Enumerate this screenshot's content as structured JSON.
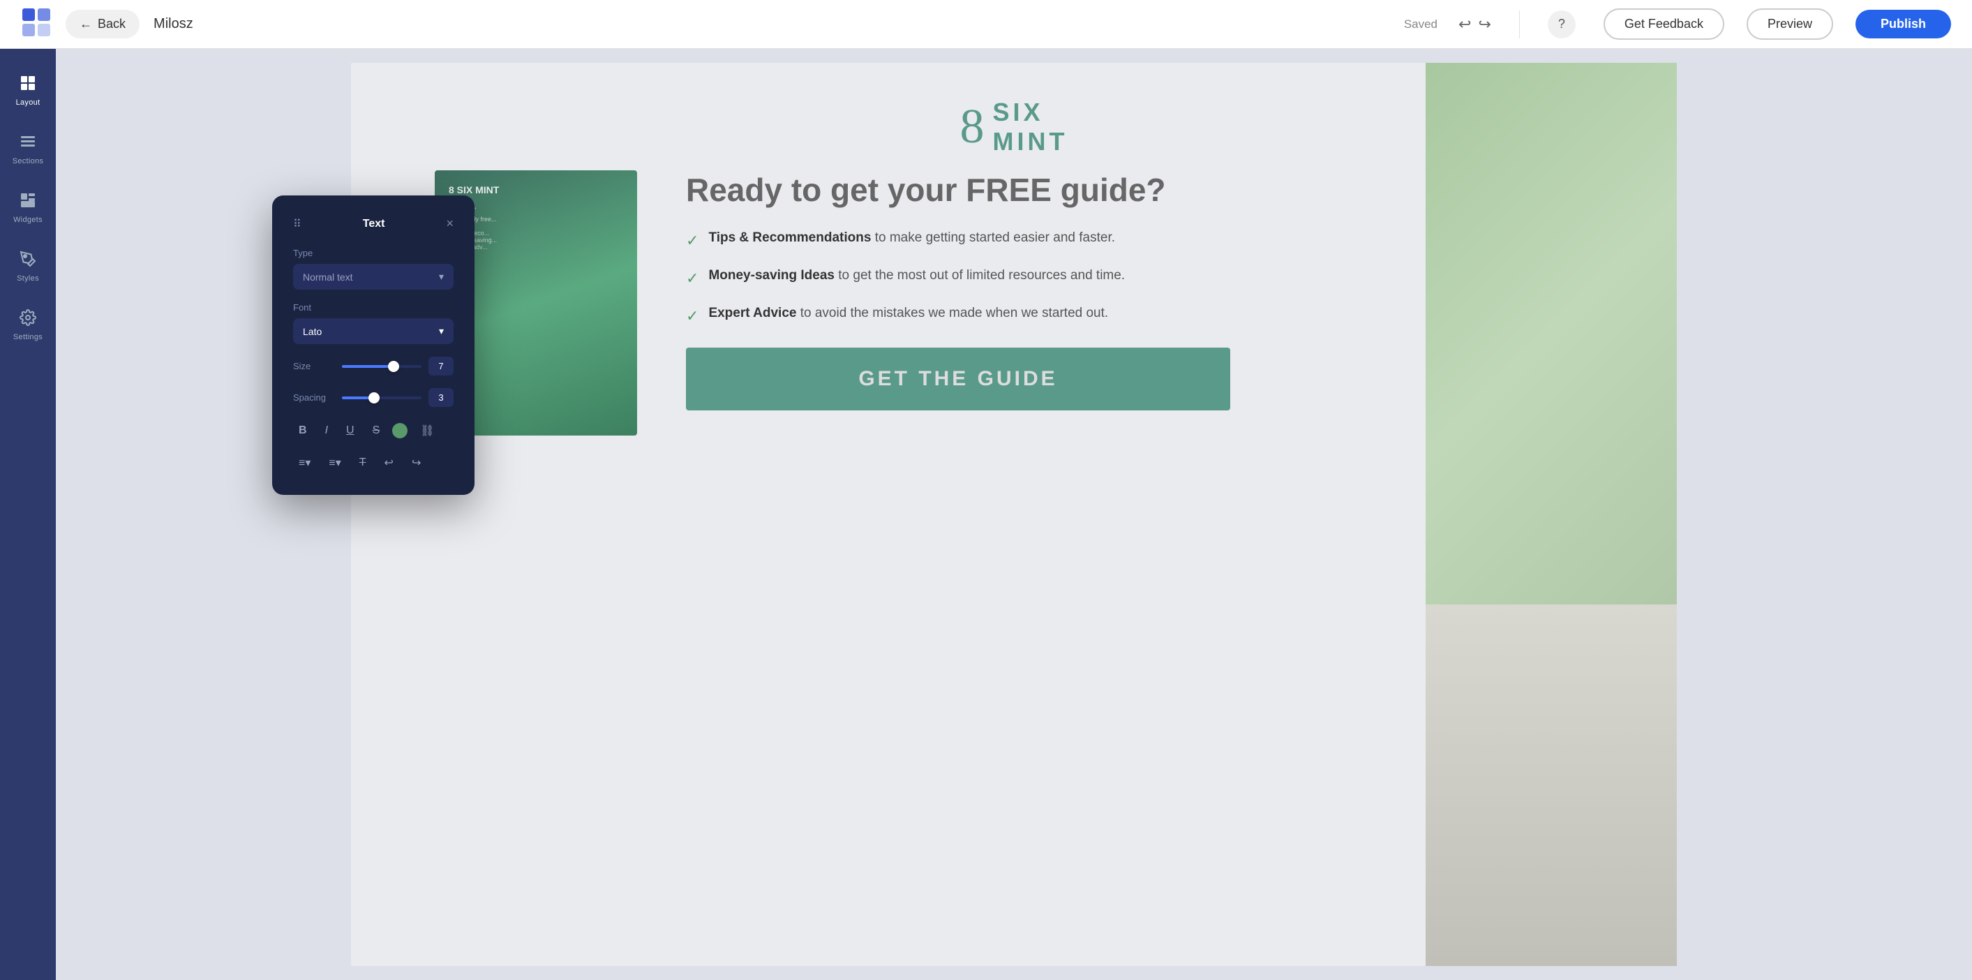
{
  "topbar": {
    "back_label": "Back",
    "title": "Milosz",
    "saved_label": "Saved",
    "help_icon": "?",
    "get_feedback_label": "Get Feedback",
    "preview_label": "Preview",
    "publish_label": "Publish"
  },
  "sidebar": {
    "items": [
      {
        "id": "layout",
        "label": "Layout",
        "icon": "⊞"
      },
      {
        "id": "sections",
        "label": "Sections",
        "icon": "☰"
      },
      {
        "id": "widgets",
        "label": "Widgets",
        "icon": "⊞"
      },
      {
        "id": "styles",
        "label": "Styles",
        "icon": "✏"
      },
      {
        "id": "settings",
        "label": "Settings",
        "icon": "⚙"
      }
    ]
  },
  "text_panel": {
    "title": "Text",
    "drag_icon": "⠿",
    "close_icon": "×",
    "type_label": "Type",
    "type_value": "Normal text",
    "type_dropdown_icon": "▾",
    "font_label": "Font",
    "font_value": "Lato",
    "font_dropdown_icon": "▾",
    "size_label": "Size",
    "size_value": "7",
    "size_slider_pct": 65,
    "spacing_label": "Spacing",
    "spacing_value": "3",
    "spacing_slider_pct": 40,
    "bold_icon": "B",
    "italic_icon": "I",
    "underline_icon": "U",
    "strikethrough_icon": "S̶",
    "color_icon": "●",
    "link_icon": "🔗",
    "align_icon": "≡",
    "list_icon": "≡",
    "clear_format_icon": "T",
    "undo_icon": "↩",
    "redo_icon": "↪"
  },
  "brand": {
    "symbol": "8",
    "line1": "SIX",
    "line2": "MINT"
  },
  "hero": {
    "heading": "Ready to get your FREE guide?",
    "benefits": [
      {
        "bold": "Tips & Recommendations",
        "rest": " to make getting started easier and faster."
      },
      {
        "bold": "Money-saving Ideas",
        "rest": " to get the most out of limited resources and time."
      },
      {
        "bold": "Expert Advice",
        "rest": " to avoid the mistakes we made when we started out."
      }
    ],
    "cta_label": "GET THE GUIDE"
  },
  "book": {
    "logo": "8 SIX MINT",
    "title": "Tips &...",
    "description": "This totally free...",
    "list": "• Tips & reco...\n• Money-saving...\n• Expert adv..."
  }
}
